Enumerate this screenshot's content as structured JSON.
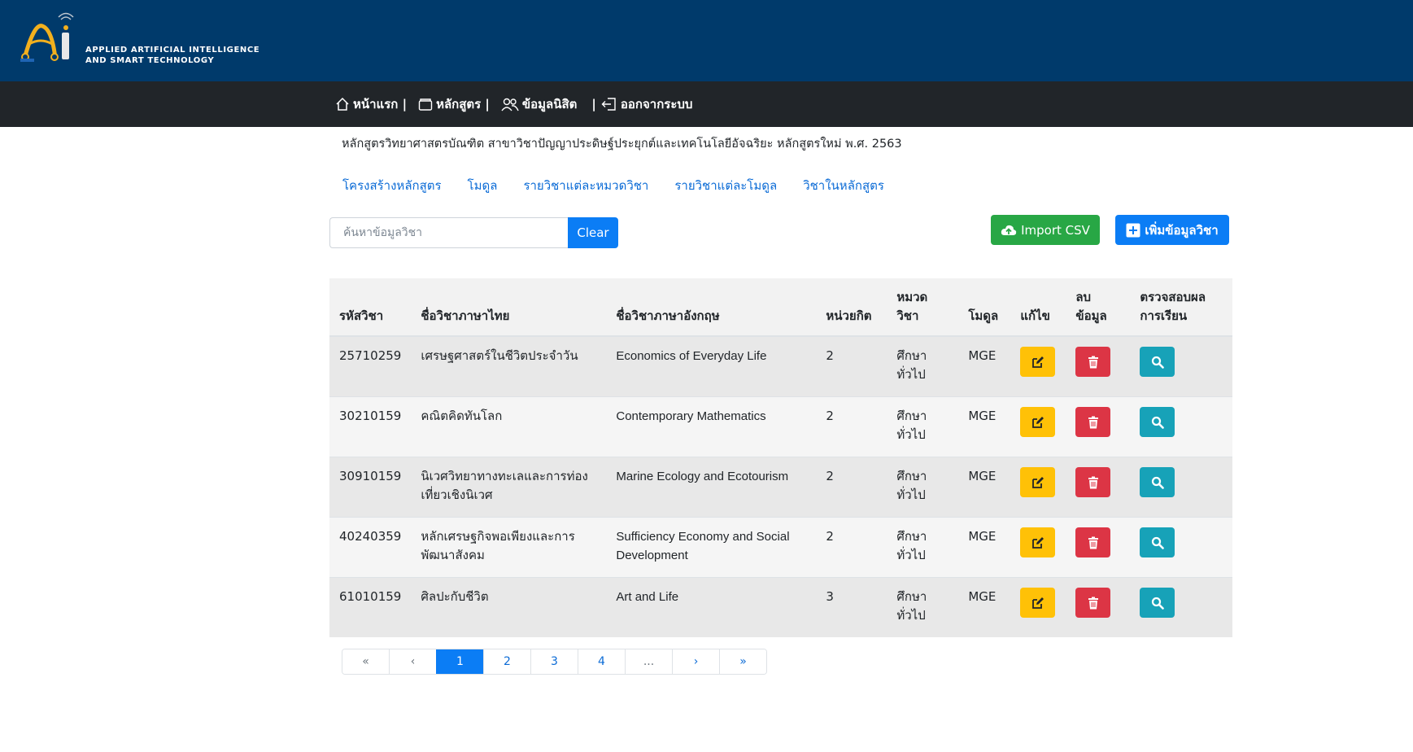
{
  "brand": {
    "line1": "APPLIED ARTIFICIAL INTELLIGENCE",
    "line2": "AND SMART TECHNOLOGY"
  },
  "nav": [
    {
      "label": "หน้าแรก |",
      "icon": "home-icon"
    },
    {
      "label": "หลักสูตร |",
      "icon": "wallet-icon"
    },
    {
      "label": "ข้อมูลนิสิต",
      "icon": "users-icon"
    },
    {
      "label": "ออกจากระบบ",
      "icon": "logout-icon"
    }
  ],
  "nav_separator": "|",
  "program_title": "หลักสูตรวิทยาศาสตรบัณฑิต สาขาวิชาปัญญาประดิษฐ์ประยุกต์และเทคโนโลยีอัจฉริยะ หลักสูตรใหม่ พ.ศ. 2563",
  "tabs": [
    "โครงสร้างหลักสูตร",
    "โมดูล",
    "รายวิชาแต่ละหมวดวิชา",
    "รายวิชาแต่ละโมดูล",
    "วิชาในหลักสูตร"
  ],
  "search": {
    "placeholder": "ค้นหาข้อมูลวิชา",
    "value": "",
    "clear_label": "Clear"
  },
  "buttons": {
    "import_label": "Import CSV",
    "add_label": "เพิ่มข้อมูลวิชา"
  },
  "table": {
    "headers": [
      "รหัสวิชา",
      "ชื่อวิชาภาษาไทย",
      "ชื่อวิชาภาษาอังกฤษ",
      "หน่วยกิต",
      "หมวด\nวิชา",
      "โมดูล",
      "แก้ไข",
      "ลบ\nข้อมูล",
      "ตรวจสอบผล\nการเรียน"
    ],
    "rows": [
      {
        "code": "25710259",
        "name_th": "เศรษฐศาสตร์ในชีวิตประจำวัน",
        "name_en": "Economics of Everyday Life",
        "credits": "2",
        "category": "ศึกษา\nทั่วไป",
        "module": "MGE"
      },
      {
        "code": "30210159",
        "name_th": "คณิตคิดทันโลก",
        "name_en": "Contemporary Mathematics",
        "credits": "2",
        "category": "ศึกษา\nทั่วไป",
        "module": "MGE"
      },
      {
        "code": "30910159",
        "name_th": "นิเวศวิทยาทางทะเลและการท่อง\nเที่ยวเชิงนิเวศ",
        "name_en": "Marine Ecology and Ecotourism",
        "credits": "2",
        "category": "ศึกษา\nทั่วไป",
        "module": "MGE"
      },
      {
        "code": "40240359",
        "name_th": "หลักเศรษฐกิจพอเพียงและการ\nพัฒนาสังคม",
        "name_en": "Sufficiency Economy and Social\nDevelopment",
        "credits": "2",
        "category": "ศึกษา\nทั่วไป",
        "module": "MGE"
      },
      {
        "code": "61010159",
        "name_th": "ศิลปะกับชีวิต",
        "name_en": "Art and Life",
        "credits": "3",
        "category": "ศึกษา\nทั่วไป",
        "module": "MGE"
      }
    ]
  },
  "pagination": {
    "pages": [
      "«",
      "‹",
      "1",
      "2",
      "3",
      "4",
      "...",
      "›",
      "»"
    ],
    "active": "1"
  },
  "colors": {
    "header_bg": "#003a6b",
    "navbar_bg": "#212529",
    "primary": "#0b7df5",
    "success": "#28a745",
    "warning": "#ffc107",
    "danger": "#dc3545",
    "info": "#17a2b8"
  }
}
